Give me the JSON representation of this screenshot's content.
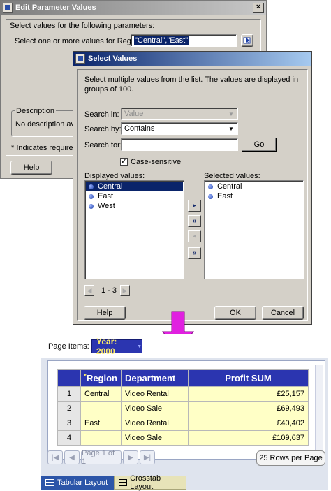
{
  "dlg1": {
    "title": "Edit Parameter Values",
    "close": "×",
    "instruction": "Select values for the following parameters:",
    "param_label": "Select one or more values for Region*:",
    "param_value": "\"Central\",\"East\"",
    "description_legend": "Description",
    "description_text": "No description avail",
    "required_note": "* Indicates required f",
    "help": "Help"
  },
  "dlg2": {
    "title": "Select Values",
    "intro": "Select multiple values from the list. The values are displayed in groups of 100.",
    "search_in_label": "Search in:",
    "search_in_value": "Value",
    "search_by_label": "Search by:",
    "search_by_value": "Contains",
    "search_for_label": "Search for:",
    "search_for_value": "",
    "go": "Go",
    "case_sensitive_label": "Case-sensitive",
    "case_sensitive_checked": "✓",
    "displayed_label": "Displayed values:",
    "selected_label": "Selected values:",
    "displayed_values": [
      "Central",
      "East",
      "West"
    ],
    "selected_values": [
      "Central",
      "East"
    ],
    "move_one": "▸",
    "move_all": "»",
    "remove_one": "◂",
    "remove_all": "«",
    "range": "1 - 3",
    "help": "Help",
    "ok": "OK",
    "cancel": "Cancel"
  },
  "report": {
    "page_items_label": "Page Items:",
    "year_selector": "Year: 2000",
    "columns": [
      "Region",
      "Department",
      "Profit SUM"
    ],
    "rows": [
      {
        "num": "1",
        "region": "Central",
        "department": "Video Rental",
        "profit": "£25,157"
      },
      {
        "num": "2",
        "region": "",
        "department": "Video Sale",
        "profit": "£69,493"
      },
      {
        "num": "3",
        "region": "East",
        "department": "Video Rental",
        "profit": "£40,402"
      },
      {
        "num": "4",
        "region": "",
        "department": "Video Sale",
        "profit": "£109,637"
      }
    ],
    "page_status": "Page 1 of 1",
    "rows_per_page": "25 Rows per Page",
    "tab_tabular": "Tabular Layout",
    "tab_crosstab": "Crosstab Layout"
  },
  "colors": {
    "header_blue": "#2b35b0",
    "cell_yellow": "#ffffc6",
    "arrow_magenta": "#e020e0",
    "selection_navy": "#0a246a"
  }
}
